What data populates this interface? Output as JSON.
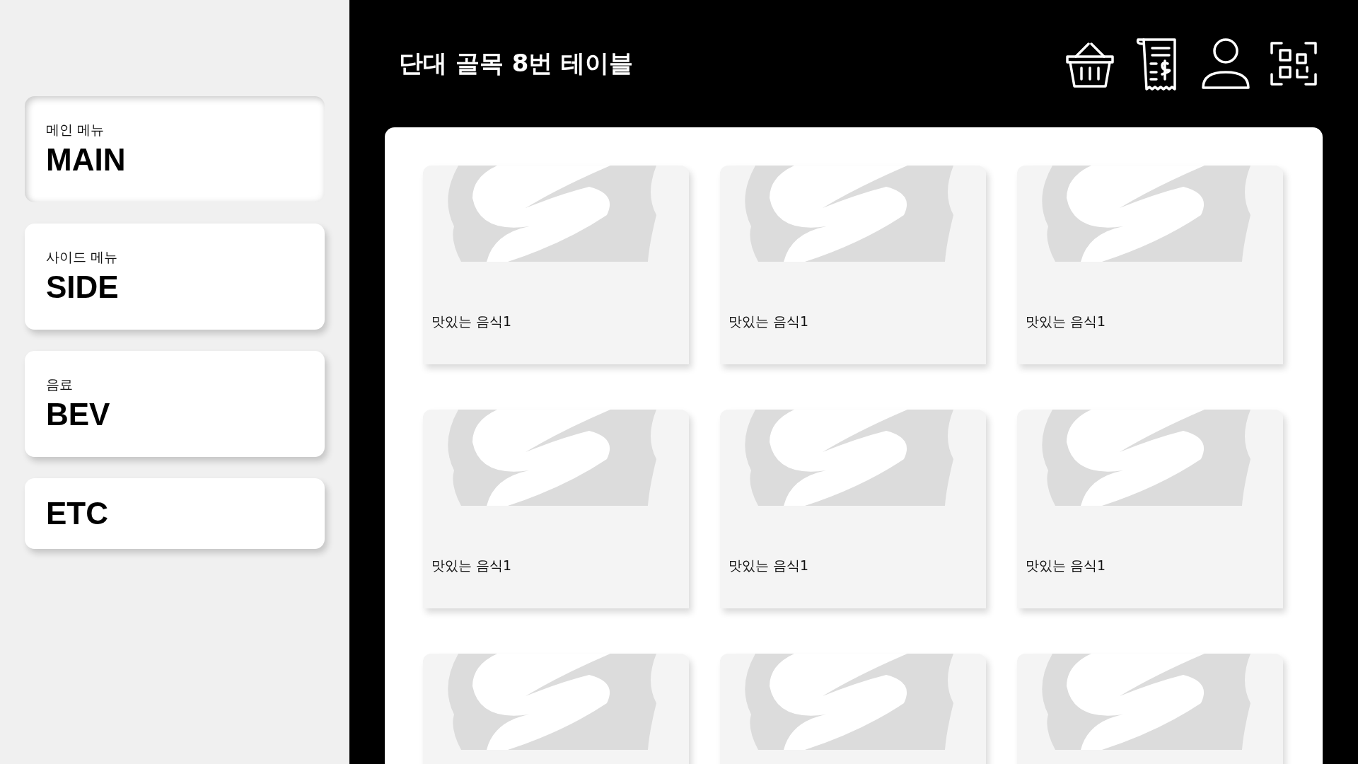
{
  "categories": [
    {
      "subtitle": "메인 메뉴",
      "title": "MAIN",
      "selected": true
    },
    {
      "subtitle": "사이드 메뉴",
      "title": "SIDE",
      "selected": false
    },
    {
      "subtitle": "음료",
      "title": "BEV",
      "selected": false
    },
    {
      "title": "ETC",
      "selected": false
    }
  ],
  "header": {
    "title": "단대 골목 8번 테이블",
    "buttons": [
      {
        "kind": "basket"
      },
      {
        "kind": "receipt"
      },
      {
        "kind": "user"
      },
      {
        "kind": "qr"
      }
    ]
  },
  "menu_items": [
    {
      "kind": "labeled",
      "name": "맛있는 음식1"
    },
    {
      "kind": "labeled",
      "name": "맛있는 음식1"
    },
    {
      "kind": "labeled",
      "name": "맛있는 음식1"
    },
    {
      "kind": "labeled",
      "name": "맛있는 음식1"
    },
    {
      "kind": "labeled",
      "name": "맛있는 음식1"
    },
    {
      "kind": "labeled",
      "name": "맛있는 음식1"
    },
    {
      "kind": "cut"
    },
    {
      "kind": "cut"
    },
    {
      "kind": "cut"
    }
  ]
}
